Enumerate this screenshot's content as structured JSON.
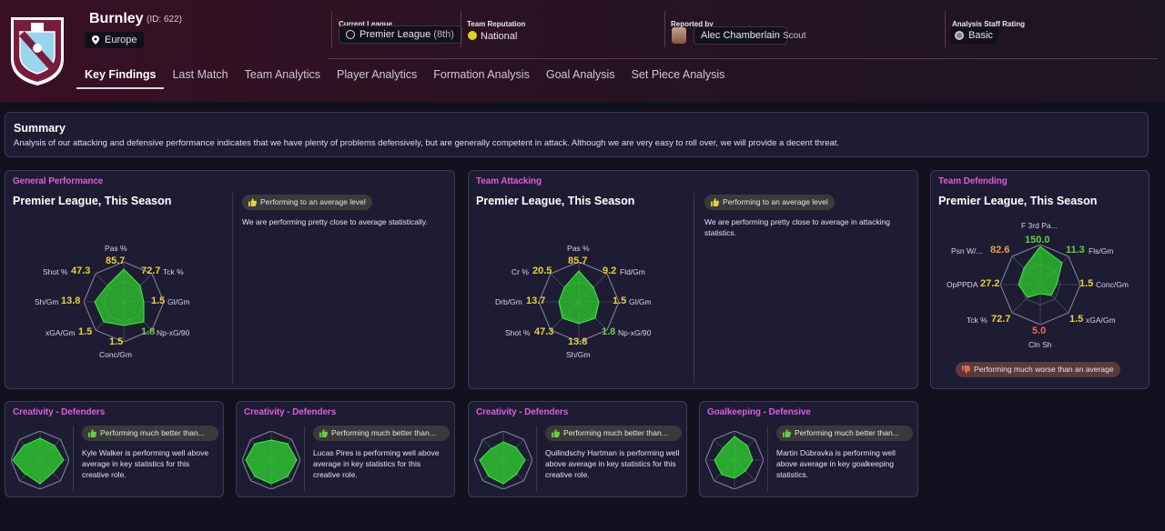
{
  "team": {
    "name": "Burnley",
    "id": "(ID: 622)",
    "region": "Europe"
  },
  "meta": {
    "league_label": "Current League",
    "league_name": "Premier League",
    "league_pos": "(8th)",
    "rep_label": "Team Reputation",
    "rep_value": "National",
    "reported_label": "Reported by",
    "scout_name": "Alec Chamberlain",
    "scout_role": "Scout",
    "staff_label": "Analysis Staff Rating",
    "staff_value": "Basic"
  },
  "tabs": [
    "Key Findings",
    "Last Match",
    "Team Analytics",
    "Player Analytics",
    "Formation Analysis",
    "Goal Analysis",
    "Set Piece Analysis"
  ],
  "summary": {
    "title": "Summary",
    "text": "Analysis of our attacking and defensive performance indicates that we have plenty of problems defensively, but are generally competent in attack. Although we are very easy to roll over, we will provide a decent threat."
  },
  "general": {
    "title": "General Performance",
    "subtitle": "Premier League, This Season",
    "badge": "Performing to an average level",
    "text": "We are performing pretty close to average statistically.",
    "stats": [
      {
        "label": "Pas %",
        "value": "85.7"
      },
      {
        "label": "Tck %",
        "value": "72.7"
      },
      {
        "label": "Gl/Gm",
        "value": "1.5"
      },
      {
        "label": "Np-xG/90",
        "value": "1.8"
      },
      {
        "label": "Conc/Gm",
        "value": "1.5"
      },
      {
        "label": "xGA/Gm",
        "value": "1.5"
      },
      {
        "label": "Sh/Gm",
        "value": "13.8"
      },
      {
        "label": "Shot %",
        "value": "47.3"
      }
    ]
  },
  "attacking": {
    "title": "Team Attacking",
    "subtitle": "Premier League, This Season",
    "badge": "Performing to an average level",
    "text": "We are performing pretty close to average in attacking statistics.",
    "stats": [
      {
        "label": "Pas %",
        "value": "85.7"
      },
      {
        "label": "Fld/Gm",
        "value": "9.2"
      },
      {
        "label": "Gl/Gm",
        "value": "1.5"
      },
      {
        "label": "Np-xG/90",
        "value": "1.8"
      },
      {
        "label": "Sh/Gm",
        "value": "13.8"
      },
      {
        "label": "Shot %",
        "value": "47.3"
      },
      {
        "label": "Drb/Gm",
        "value": "13.7"
      },
      {
        "label": "Cr %",
        "value": "20.5"
      }
    ]
  },
  "defending": {
    "title": "Team Defending",
    "subtitle": "Premier League, This Season",
    "badge": "Performing much worse than an average",
    "stats": [
      {
        "label": "F 3rd Pa...",
        "value": "150.0"
      },
      {
        "label": "Fls/Gm",
        "value": "11.3"
      },
      {
        "label": "Conc/Gm",
        "value": "1.5"
      },
      {
        "label": "xGA/Gm",
        "value": "1.5"
      },
      {
        "label": "Cln Sh",
        "value": "5.0"
      },
      {
        "label": "Tck %",
        "value": "72.7"
      },
      {
        "label": "OpPPDA",
        "value": "27.2"
      },
      {
        "label": "Psn W/...",
        "value": "82.6"
      }
    ]
  },
  "cards": [
    {
      "title": "Creativity - Defenders",
      "badge": "Performing much better than...",
      "text": "Kyle Walker is performing well above average in key statistics for this creative role."
    },
    {
      "title": "Creativity - Defenders",
      "badge": "Performing much better than...",
      "text": "Lucas Pires is performing well above average in key statistics for this creative role."
    },
    {
      "title": "Creativity - Defenders",
      "badge": "Performing much better than...",
      "text": "Quilindschy Hartman is performing well above average in key statistics for this creative role."
    },
    {
      "title": "Goalkeeping - Defensive",
      "badge": "Performing much better than...",
      "text": "Martin Dúbravka is performing well above average in key goalkeeping statistics."
    }
  ],
  "colors": {
    "accent": "#e05adf",
    "radar_fill": "#2ecc2e",
    "good": "#66d13a",
    "average": "#e8cf3a",
    "poor": "#f06a4a"
  }
}
